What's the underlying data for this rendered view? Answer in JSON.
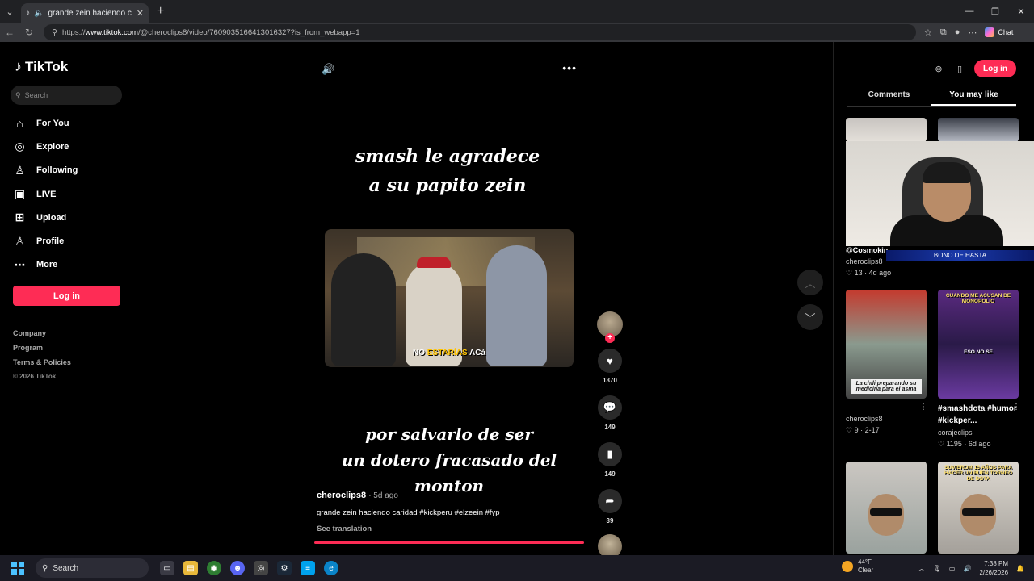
{
  "browser": {
    "tab_title": "grande zein haciendo caridad",
    "url_prefix": "https://",
    "url_host": "www.tiktok.com",
    "url_path": "/@cheroclips8/video/7609035166413016327?is_from_webapp=1",
    "chat_label": "Chat"
  },
  "sidebar": {
    "logo": "TikTok",
    "search_placeholder": "Search",
    "nav": [
      {
        "label": "For You",
        "icon": "home-icon"
      },
      {
        "label": "Explore",
        "icon": "compass-icon"
      },
      {
        "label": "Following",
        "icon": "user-follow-icon"
      },
      {
        "label": "LIVE",
        "icon": "live-icon"
      },
      {
        "label": "Upload",
        "icon": "plus-square-icon"
      },
      {
        "label": "Profile",
        "icon": "user-icon"
      },
      {
        "label": "More",
        "icon": "more-dots-icon"
      }
    ],
    "login_label": "Log in",
    "footer": [
      "Company",
      "Program",
      "Terms & Policies",
      "© 2026 TikTok"
    ]
  },
  "video": {
    "caption_top_1": "smash le agradece",
    "caption_top_2": "a su papito zein",
    "clip_subtitle_1": "NO",
    "clip_subtitle_2": "ESTARÍAS",
    "clip_subtitle_3": "ACá",
    "caption_bottom_1": "por salvarlo de ser",
    "caption_bottom_2": "un dotero fracasado del monton",
    "author": "cheroclips8",
    "posted": "· 5d ago",
    "description": "grande zein haciendo caridad #kickperu #elzeein #fyp",
    "see_translation": "See translation",
    "progress": 1.0
  },
  "actions": {
    "likes": "1370",
    "comments": "149",
    "saves": "149",
    "shares": "39"
  },
  "right_panel": {
    "login_label": "Log in",
    "tabs": [
      "Comments",
      "You may like"
    ],
    "active_tab": "You may like",
    "items": [
      {
        "user": "@Cosmokin",
        "uname": "cheroclips8",
        "stats": "♡ 13 · 4d ago"
      },
      {
        "title": "#smashdota #humor #kickper...",
        "uname": "corajeclips",
        "stats": "♡ 1195 · 6d ago"
      },
      {
        "caption": "La chili preparando su medicina para el asma",
        "uname": "cheroclips8",
        "stats": "♡ 9 · 2-17"
      },
      {
        "overlay_top": "CUANDO ME ACUSAN DE MONOPOLIO",
        "overlay_mid": "ESO NO SE"
      },
      {
        "overlay_top": "SUVIEROM 15 AÑOS PARA HACER UN BUEN TORNEO DE DOTA"
      }
    ],
    "cam_banner": "BONO DE HASTA",
    "cam_strip": "@Cosmokin"
  },
  "taskbar": {
    "search": "Search",
    "weather_temp": "44°F",
    "weather_desc": "Clear",
    "time": "7:38 PM",
    "date": "2/26/2026"
  }
}
